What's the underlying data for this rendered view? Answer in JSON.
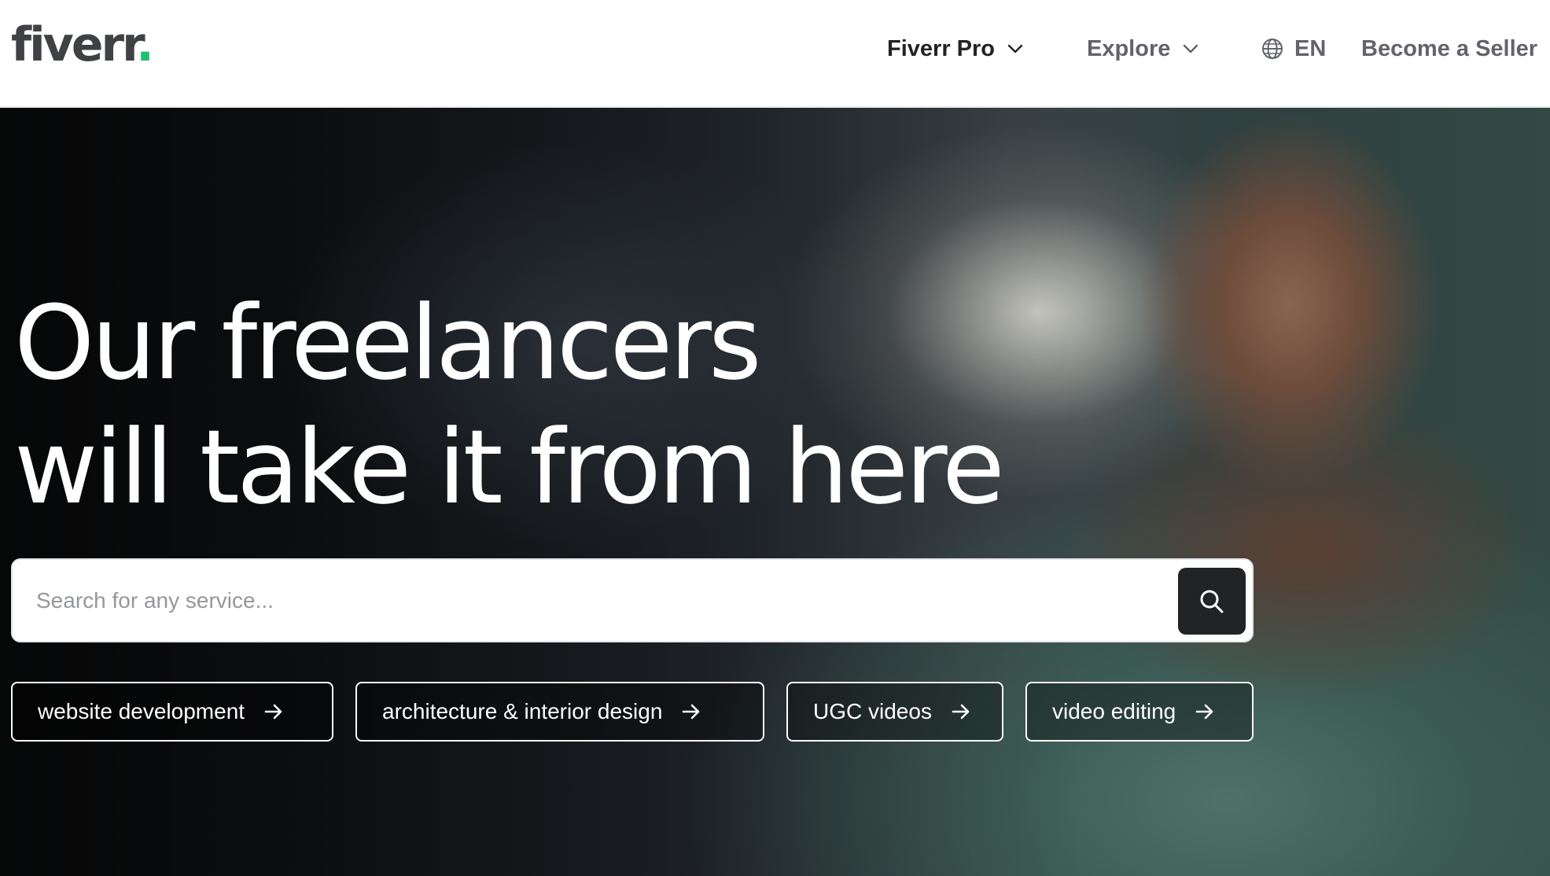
{
  "header": {
    "logo_text": "fiverr",
    "logo_dot": ".",
    "nav": {
      "pro_label": "Fiverr Pro",
      "explore_label": "Explore",
      "language_label": "EN",
      "seller_label": "Become a Seller"
    }
  },
  "hero": {
    "title_line1": "Our freelancers",
    "title_line2": "will take it from here",
    "search": {
      "placeholder": "Search for any service...",
      "value": ""
    },
    "suggestions": [
      {
        "label": "website development"
      },
      {
        "label": "architecture & interior design"
      },
      {
        "label": "UGC videos"
      },
      {
        "label": "video editing"
      }
    ]
  },
  "colors": {
    "brand_green": "#1dbf73",
    "text_dark": "#404145",
    "search_button": "#222325"
  },
  "icons": [
    "chevron-down-icon",
    "globe-icon",
    "search-icon",
    "arrow-right-icon"
  ]
}
